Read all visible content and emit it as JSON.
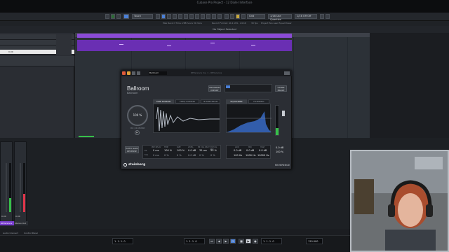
{
  "window": {
    "title": "Cubase Pro Project - 12 Dialer Interface"
  },
  "toolbar": {
    "mode": "Touch",
    "grid": "Grid",
    "quantize": "1/16 Use Quantize",
    "quant_value": "1/4",
    "quant_value2": "1/16 Off Off"
  },
  "infoline": {
    "max_record_time": "Max Record Time: 288 hours 30 mins",
    "record_format": "Record Format: 44.1 kHz - 24 bit",
    "frame_rate": "30 fps",
    "pan_law": "Project Pan Law: Equal Power"
  },
  "status": {
    "text": "No Object Selected"
  },
  "inspector": {
    "selected_value": "0.00"
  },
  "plugin": {
    "header_title": "REVerence Ins. 1 - REVerence",
    "preset_field": "Ballroom",
    "preset_name": "Ballroom",
    "preset_sub": "Ballroom",
    "btn_program": "PROGRAM",
    "btn_import": "IMPORT",
    "btn_store": "STORE",
    "btn_erase": "ERASE",
    "mix_value": "100 %",
    "mix_label": "MIX / IR REVERB",
    "tab_time": "TIME DOMAIN",
    "tab_freq": "FREQ DOMAIN",
    "tab_ir": "IR SPECTRUM",
    "tab_eq": "EQUALIZER",
    "tab_filter": "FILTERING",
    "params": [
      {
        "label": "PRE DELAY",
        "value": "0 ms"
      },
      {
        "label": "TIME",
        "value": "100 %"
      },
      {
        "label": "SIZE",
        "value": "100 %"
      },
      {
        "label": "LEVEL",
        "value": "0.0 dB"
      },
      {
        "label": "ER TAIL SPLIT",
        "value": "35 ms"
      },
      {
        "label": "ER TAIL MIX",
        "value": "50 %"
      }
    ],
    "params_b": [
      {
        "label": "ER",
        "value": "0 ms"
      },
      {
        "label": "TAIL",
        "value": "0 %"
      },
      {
        "label": "",
        "value": "0 %"
      },
      {
        "label": "",
        "value": "0.0 dB"
      },
      {
        "label": "",
        "value": "0 %"
      },
      {
        "label": "",
        "value": "0 %"
      }
    ],
    "eq": [
      {
        "label": "LOW",
        "value": "0.0 dB"
      },
      {
        "label": "MID",
        "value": "0.0 dB"
      },
      {
        "label": "HIGH",
        "value": "0.0 dB"
      }
    ],
    "eq_freq": [
      {
        "value": "100 Hz"
      },
      {
        "value": "1000 Hz"
      },
      {
        "value": "10000 Hz"
      }
    ],
    "output_value": "0.0 dB",
    "output_mix": "100 %",
    "auto_gain": "AUTO GAIN",
    "reverse": "REVERSE",
    "brand": "steinberg",
    "product": "REVERENCE"
  },
  "mixer": {
    "channel_values": [
      "0.00",
      "0.00"
    ],
    "channel_names": [
      "REVerence",
      "Stereo Out"
    ]
  },
  "transport": {
    "position_a": "1. 1. 1. 0",
    "position_b": "1. 1. 1. 0",
    "position_c": "1. 1. 1. 0",
    "tempo": "120.000",
    "left_label_a": "Audio Connect",
    "left_label_b": "Control Panel"
  },
  "colors": {
    "event": "#8b4bd6",
    "accent_green": "#37c04a",
    "meter_red": "#e0364a",
    "active_blue": "#4a7fd6"
  }
}
